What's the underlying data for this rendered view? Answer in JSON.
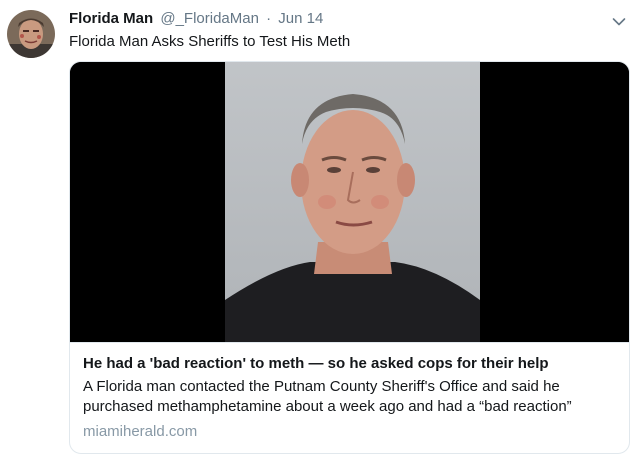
{
  "tweet": {
    "author_name": "Florida Man",
    "handle": "@_FloridaMan",
    "separator": "·",
    "date": "Jun 14",
    "text": "Florida Man Asks Sheriffs to Test His Meth",
    "menu_icon": "chevron-down-icon",
    "avatar_icon": "avatar"
  },
  "card": {
    "title": "He had a 'bad reaction' to meth — so he asked cops for their help",
    "description_lines": [
      "A Florida man contacted the Putnam County Sheriff's Office and said he",
      "purchased methamphetamine about a week ago and had a “bad reaction”"
    ],
    "domain": "miamiherald.com",
    "image_icon": "mugshot-photo"
  },
  "colors": {
    "text_primary": "#14171a",
    "text_secondary": "#657786",
    "domain_text": "#8899a6",
    "card_border": "#e1e8ed",
    "image_background": "#000000",
    "photo_backdrop": "#b9bdc1"
  }
}
